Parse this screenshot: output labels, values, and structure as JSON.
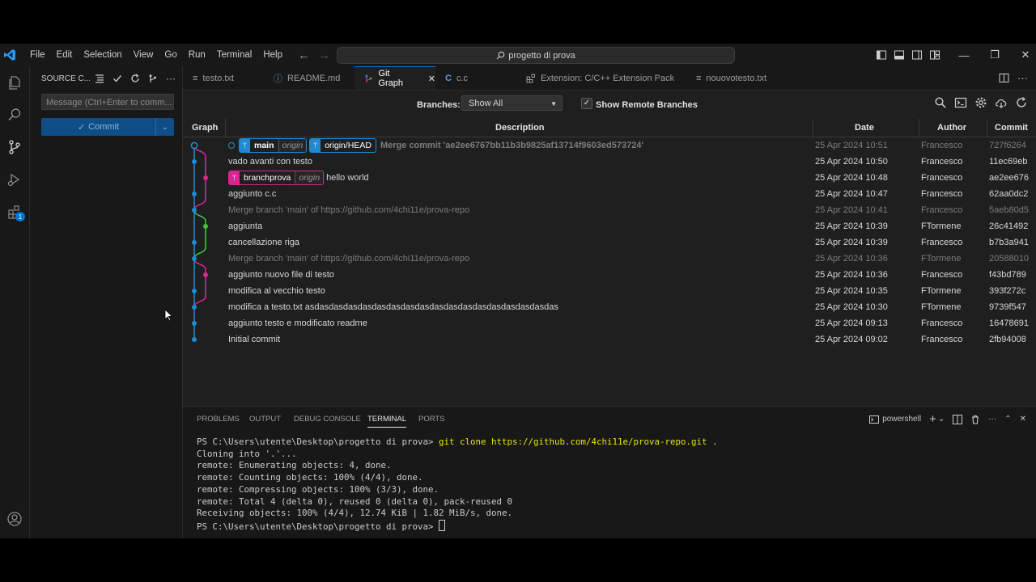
{
  "titlebar": {
    "menu": [
      "File",
      "Edit",
      "Selection",
      "View",
      "Go",
      "Run",
      "Terminal",
      "Help"
    ],
    "search": "progetto di prova"
  },
  "sidebar": {
    "title": "SOURCE C...",
    "message_placeholder": "Message (Ctrl+Enter to comm...",
    "commit_label": "Commit",
    "extensions_badge": "1"
  },
  "tabs": [
    {
      "label": "testo.txt",
      "icon": "lines-icon"
    },
    {
      "label": "README.md",
      "icon": "info-icon"
    },
    {
      "label": "Git Graph",
      "icon": "git-graph-icon",
      "active": true
    },
    {
      "label": "c.c",
      "icon": "c-icon"
    },
    {
      "label": "Extension: C/C++ Extension Pack",
      "icon": "extension-icon"
    },
    {
      "label": "nouovotesto.txt",
      "icon": "lines-icon"
    }
  ],
  "toolbar": {
    "branches_label": "Branches:",
    "branches_value": "Show All",
    "show_remote_label": "Show Remote Branches",
    "show_remote_checked": true
  },
  "table": {
    "columns": [
      "Graph",
      "Description",
      "Date",
      "Author",
      "Commit"
    ],
    "rows": [
      {
        "desc": "Merge commit 'ae2ee6767bb11b3b9825af13714f9603ed573724'",
        "date": "25 Apr 2024 10:51",
        "author": "Francesco",
        "hash": "727f6264",
        "dim": true,
        "bold": true
      },
      {
        "desc": "vado avanti con testo",
        "date": "25 Apr 2024 10:50",
        "author": "Francesco",
        "hash": "11ec69eb"
      },
      {
        "desc": "hello world",
        "date": "25 Apr 2024 10:48",
        "author": "Francesco",
        "hash": "ae2ee676"
      },
      {
        "desc": "aggiunto c.c",
        "date": "25 Apr 2024 10:47",
        "author": "Francesco",
        "hash": "62aa0dc2"
      },
      {
        "desc": "Merge branch 'main' of https://github.com/4chi11e/prova-repo",
        "date": "25 Apr 2024 10:41",
        "author": "Francesco",
        "hash": "5aeb80d5",
        "dim": true
      },
      {
        "desc": "aggiunta",
        "date": "25 Apr 2024 10:39",
        "author": "FTormene",
        "hash": "26c41492"
      },
      {
        "desc": "cancellazione riga",
        "date": "25 Apr 2024 10:39",
        "author": "Francesco",
        "hash": "b7b3a941"
      },
      {
        "desc": "Merge branch 'main' of https://github.com/4chi11e/prova-repo",
        "date": "25 Apr 2024 10:36",
        "author": "FTormene",
        "hash": "20588010",
        "dim": true
      },
      {
        "desc": "aggiunto nuovo file di testo",
        "date": "25 Apr 2024 10:36",
        "author": "Francesco",
        "hash": "f43bd789"
      },
      {
        "desc": "modifica al vecchio testo",
        "date": "25 Apr 2024 10:35",
        "author": "FTormene",
        "hash": "393f272c"
      },
      {
        "desc": "modifica a testo.txt asdasdasdasdasdasdasdasdasdasdasdasdasdasdasdasdasdas",
        "date": "25 Apr 2024 10:30",
        "author": "FTormene",
        "hash": "9739f547"
      },
      {
        "desc": "aggiunto testo e modificato readme",
        "date": "25 Apr 2024 09:13",
        "author": "Francesco",
        "hash": "16478691"
      },
      {
        "desc": "Initial commit",
        "date": "25 Apr 2024 09:02",
        "author": "Francesco",
        "hash": "2fb94008"
      }
    ]
  },
  "refs": {
    "main": "main",
    "origin": "origin",
    "origin_head": "origin/HEAD",
    "branchprova": "branchprova",
    "branchprova_origin": "origin"
  },
  "colors": {
    "blue": "#1f8ad2",
    "magenta": "#d9258f",
    "green": "#3cc43c",
    "accent": "#0078d4"
  },
  "panel": {
    "tabs": [
      "PROBLEMS",
      "OUTPUT",
      "DEBUG CONSOLE",
      "TERMINAL",
      "PORTS"
    ],
    "active_tab": "TERMINAL",
    "shell": "powershell",
    "prompt": "PS C:\\Users\\utente\\Desktop\\progetto di prova>",
    "command": "git clone https://github.com/4chi11e/prova-repo.git .",
    "output": [
      "Cloning into '.'...",
      "remote: Enumerating objects: 4, done.",
      "remote: Counting objects: 100% (4/4), done.",
      "remote: Compressing objects: 100% (3/3), done.",
      "remote: Total 4 (delta 0), reused 0 (delta 0), pack-reused 0",
      "Receiving objects: 100% (4/4), 12.74 KiB | 1.82 MiB/s, done."
    ]
  }
}
